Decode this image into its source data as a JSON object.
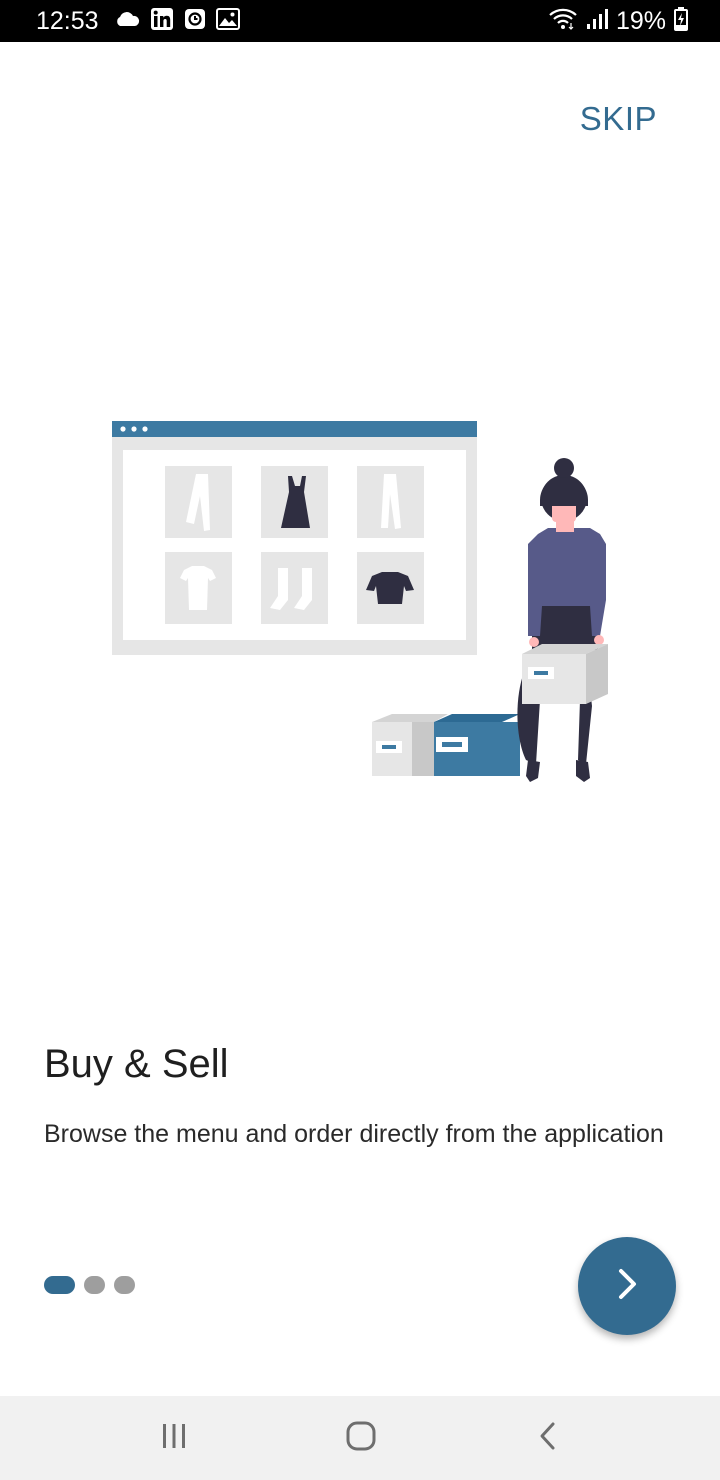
{
  "status_bar": {
    "time": "12:53",
    "battery": "19%",
    "left_icons": [
      "cloud-icon",
      "linkedin-icon",
      "clock-app-icon",
      "gallery-icon"
    ],
    "right_icons": [
      "wifi-icon",
      "signal-icon",
      "battery-charging-icon"
    ]
  },
  "header": {
    "skip_label": "SKIP"
  },
  "slide": {
    "title": "Buy & Sell",
    "description": "Browse the menu and order directly from the application",
    "illustration": "online-store-illustration"
  },
  "pager": {
    "total": 3,
    "current": 1
  },
  "next_button": {
    "icon": "chevron-right-icon"
  },
  "colors": {
    "accent": "#336b90",
    "inactive_dot": "#9e9e9e",
    "text": "#1f1f1f"
  },
  "nav_bar": {
    "icons": [
      "recent-apps-icon",
      "home-icon",
      "back-icon"
    ]
  }
}
